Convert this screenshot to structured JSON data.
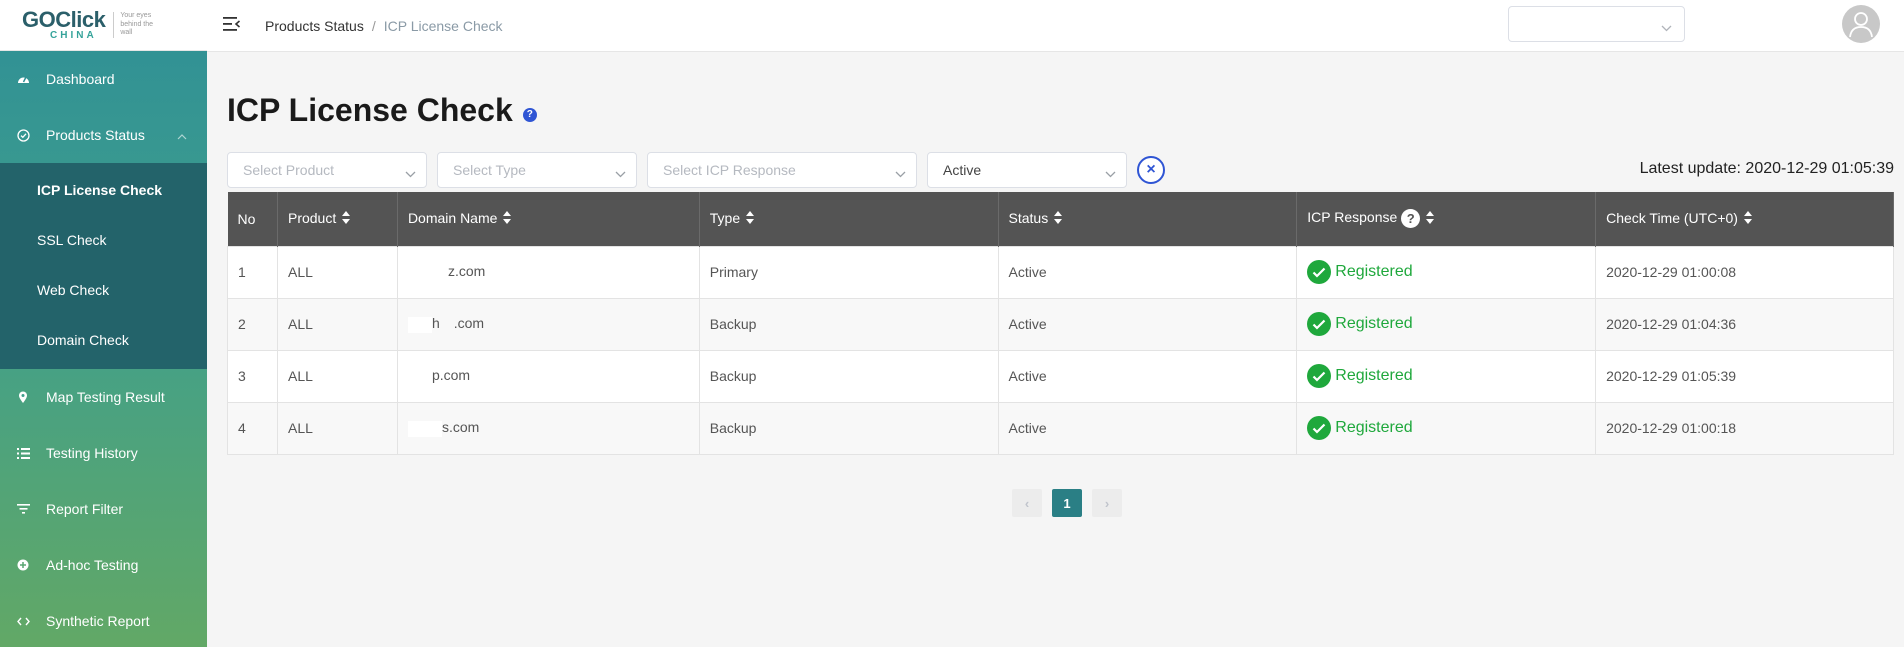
{
  "logo": {
    "brand_go": "GO",
    "brand_click": "Click",
    "brand_china": "CHINA",
    "tagline": "Your eyes behind the wall"
  },
  "sidebar": {
    "items": [
      {
        "label": "Dashboard",
        "icon": "dashboard-icon"
      },
      {
        "label": "Products Status",
        "icon": "check-circle-icon"
      },
      {
        "label": "Map Testing Result",
        "icon": "map-pin-icon"
      },
      {
        "label": "Testing History",
        "icon": "list-icon"
      },
      {
        "label": "Report Filter",
        "icon": "filter-icon"
      },
      {
        "label": "Ad-hoc Testing",
        "icon": "plus-circle-icon"
      },
      {
        "label": "Synthetic Report",
        "icon": "code-icon"
      }
    ],
    "subitems": [
      {
        "label": "ICP License Check"
      },
      {
        "label": "SSL Check"
      },
      {
        "label": "Web Check"
      },
      {
        "label": "Domain Check"
      }
    ]
  },
  "breadcrumb": {
    "parent": "Products Status",
    "separator": "/",
    "current": "ICP License Check"
  },
  "page": {
    "title": "ICP License Check",
    "help": "?",
    "latest_update": "Latest update: 2020-12-29 01:05:39"
  },
  "filters": {
    "product_placeholder": "Select Product",
    "type_placeholder": "Select Type",
    "icp_placeholder": "Select ICP Response",
    "status_value": "Active",
    "clear": "×"
  },
  "table": {
    "headers": {
      "no": "No",
      "product": "Product",
      "domain": "Domain Name",
      "type": "Type",
      "status": "Status",
      "icp": "ICP Response",
      "icp_help": "?",
      "check_time": "Check Time (UTC+0)"
    },
    "rows": [
      {
        "no": "1",
        "product": "ALL",
        "domain_pre": "",
        "domain": "z.com",
        "type": "Primary",
        "status": "Active",
        "icp": "Registered",
        "time": "2020-12-29 01:00:08"
      },
      {
        "no": "2",
        "product": "ALL",
        "domain_pre": "h",
        "domain": ".com",
        "type": "Backup",
        "status": "Active",
        "icp": "Registered",
        "time": "2020-12-29 01:04:36"
      },
      {
        "no": "3",
        "product": "ALL",
        "domain_pre": "",
        "domain": "p.com",
        "type": "Backup",
        "status": "Active",
        "icp": "Registered",
        "time": "2020-12-29 01:05:39"
      },
      {
        "no": "4",
        "product": "ALL",
        "domain_pre": "",
        "domain": "s.com",
        "type": "Backup",
        "status": "Active",
        "icp": "Registered",
        "time": "2020-12-29 01:00:18"
      }
    ]
  },
  "pagination": {
    "prev": "‹",
    "current": "1",
    "next": "›"
  },
  "colors": {
    "accent": "#2a7f85",
    "success": "#1fa83c",
    "header_bg": "#545454",
    "link_blue": "#2f55d4"
  }
}
